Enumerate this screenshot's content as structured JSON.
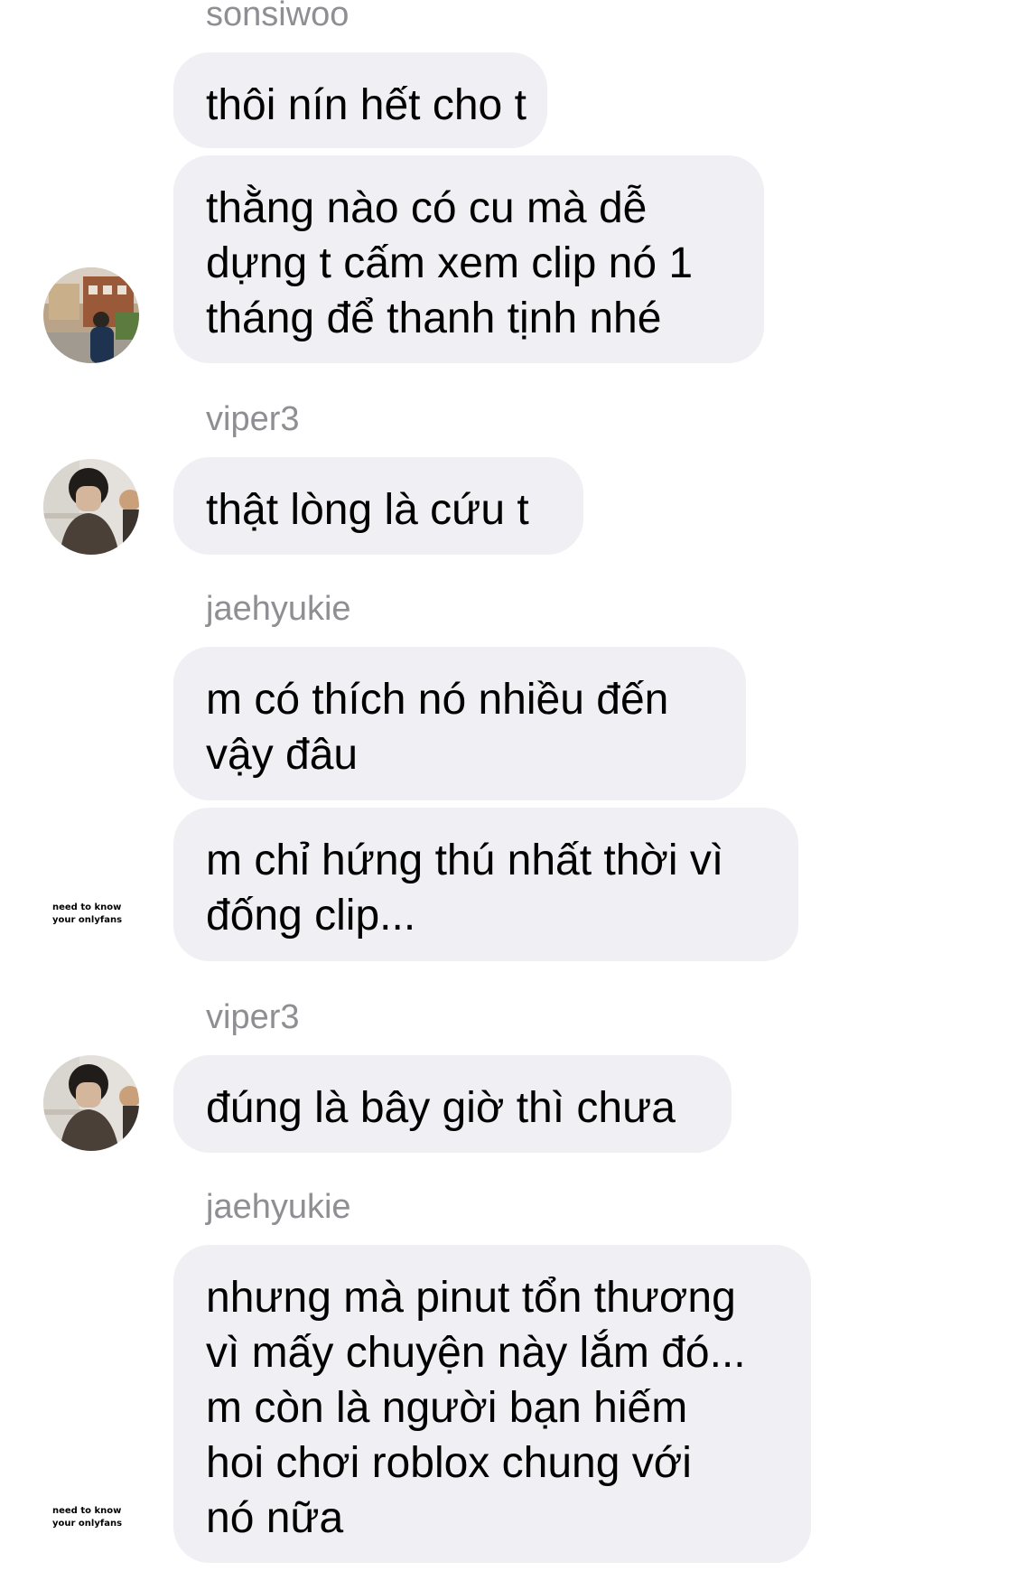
{
  "messages": [
    {
      "sender": "sonsiwoo",
      "lines": [
        "thôi nín hết cho t"
      ]
    },
    {
      "lines": [
        "thằng nào có cu mà dễ",
        "dựng t cấm xem clip nó 1",
        "tháng để thanh tịnh nhé"
      ]
    },
    {
      "sender": "viper3",
      "lines": [
        "thật lòng là cứu t"
      ]
    },
    {
      "sender": "jaehyukie",
      "lines": [
        "m có thích nó nhiều đến",
        "vậy đâu"
      ]
    },
    {
      "lines": [
        "m chỉ hứng thú nhất thời vì",
        "đống clip..."
      ]
    },
    {
      "sender": "viper3",
      "lines": [
        "đúng là bây giờ thì chưa"
      ]
    },
    {
      "sender": "jaehyukie",
      "lines": [
        "nhưng mà pinut tổn thương",
        "vì mấy chuyện này lắm đó...",
        "m còn là người bạn hiếm",
        "hoi chơi roblox chung với",
        "nó nữa"
      ]
    }
  ],
  "avatar_text": {
    "line1": "need to know",
    "line2": "your onlyfans"
  },
  "colors": {
    "bubble": "#efeff4",
    "sender_name": "#8e8e93",
    "text": "#000000",
    "background": "#ffffff"
  }
}
